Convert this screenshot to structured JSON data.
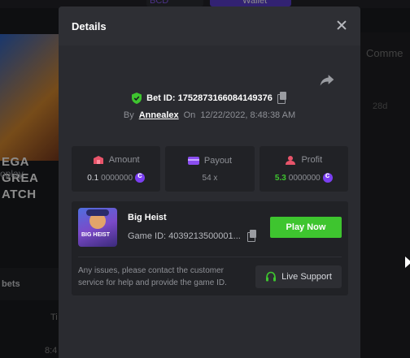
{
  "background": {
    "currency": "BCD",
    "wallet_label": "Wallet",
    "banner_text": "EGA GREA ATCH",
    "play_label": "oplay",
    "bets_tab": "bets",
    "comment_label": "Comme",
    "date": "28d",
    "col_ti": "Ti",
    "time": "8:4"
  },
  "modal": {
    "title": "Details",
    "bet_id": "Bet ID: 1752873166084149376",
    "by_label": "By",
    "user": "Annealex",
    "on_label": "On",
    "datetime": "12/22/2022, 8:48:38 AM",
    "stats": {
      "amount_label": "Amount",
      "amount_value_prefix": "0.1",
      "amount_value_suffix": "0000000",
      "payout_label": "Payout",
      "payout_value": "54 x",
      "profit_label": "Profit",
      "profit_value_prefix": "5.3",
      "profit_value_suffix": "0000000"
    },
    "game": {
      "name": "Big Heist",
      "thumb_text": "BIG HEIST",
      "game_id": "Game ID: 4039213500001...",
      "play_button": "Play Now",
      "support_text": "Any issues, please contact the customer service for help and provide the game ID.",
      "support_button": "Live Support"
    }
  },
  "colors": {
    "accent_green": "#3ec52f",
    "coin_purple": "#7b3ff2",
    "amount_icon": "#e8546a",
    "payout_icon": "#8a4df0",
    "profit_icon": "#e8546a"
  },
  "icons": [
    "close-icon",
    "share-icon",
    "shield-check-icon",
    "copy-icon",
    "coin-icon",
    "headset-icon"
  ]
}
